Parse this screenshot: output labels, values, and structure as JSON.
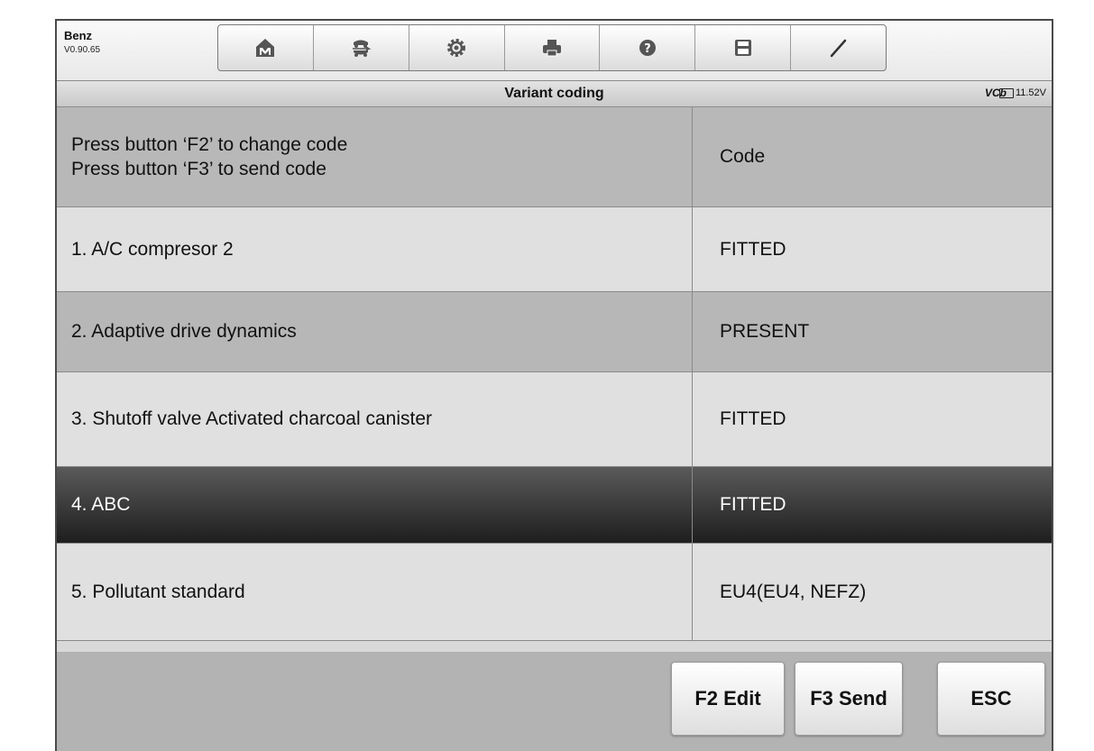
{
  "app": {
    "name": "Benz",
    "version": "V0.90.65"
  },
  "toolbar": {
    "buttons": [
      {
        "icon": "home-icon"
      },
      {
        "icon": "vehicle-swap-icon"
      },
      {
        "icon": "gear-icon"
      },
      {
        "icon": "printer-icon"
      },
      {
        "icon": "help-icon"
      },
      {
        "icon": "save-icon"
      },
      {
        "icon": "pen-icon"
      }
    ]
  },
  "titlebar": {
    "title": "Variant coding",
    "vci": "VCb",
    "voltage": "11.52V"
  },
  "table": {
    "header": {
      "instruction_1": "Press button ‘F2’ to change code",
      "instruction_2": "Press button ‘F3’ to send code",
      "code_label": "Code"
    },
    "rows": [
      {
        "label": "1. A/C compresor 2",
        "value": "FITTED",
        "selected": false
      },
      {
        "label": "2. Adaptive drive dynamics",
        "value": "PRESENT",
        "selected": false
      },
      {
        "label": "3. Shutoff valve Activated charcoal canister",
        "value": "FITTED",
        "selected": false
      },
      {
        "label": "4. ABC",
        "value": "FITTED",
        "selected": true
      },
      {
        "label": "5. Pollutant standard",
        "value": "EU4(EU4, NEFZ)",
        "selected": false
      }
    ]
  },
  "footer": {
    "f2_label": "F2 Edit",
    "f3_label": "F3 Send",
    "esc_label": "ESC"
  },
  "colors": {
    "selected_row": "#2a2a2a",
    "row_light": "#e0e0e0",
    "row_dark": "#b7b7b7"
  }
}
